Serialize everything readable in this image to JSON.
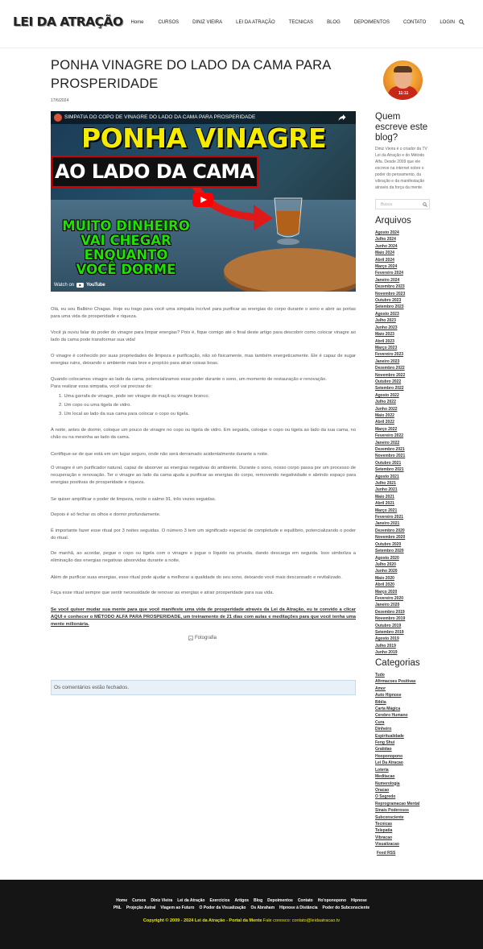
{
  "header": {
    "logo": "LEI DA ATRAÇÃO",
    "nav": [
      "Home",
      "CURSOS",
      "DINIZ VIEIRA",
      "LEI DA ATRAÇÃO",
      "TECNICAS",
      "BLOG",
      "DEPOIMENTOS",
      "CONTATO",
      "LOGIN"
    ],
    "search_icon": "search-icon"
  },
  "post": {
    "title": "PONHA VINAGRE DO LADO DA CAMA PARA PROSPERIDADE",
    "date": "17/6/2024",
    "video": {
      "top_title": "SIMPATIA DO COPO DE VINAGRE DO LADO DA CAMA PARA PROSPERIDADE",
      "thumb_line1": "PONHA VINAGRE",
      "thumb_line2": "AO LADO DA CAMA",
      "thumb_line3": [
        "MUITO DINHEIRO",
        "VAI CHEGAR",
        "ENQUANTO",
        "VOCÊ DORME"
      ],
      "watch_on": "Watch on",
      "platform": "YouTube"
    },
    "paragraphs": [
      "Olá, eu sou Balbino Chagas. Hoje eu trago para você uma simpatia incrível para purificar as energias do corpo durante o sono e abrir as portas para uma vida de prosperidade e riqueza.",
      "Você já ouviu falar do poder do vinagre para limpar energias? Pois é, fique comigo até o final deste artigo para descobrir como colocar vinagre ao lado da cama pode transformar sua vida!",
      "O vinagre é conhecido por suas propriedades de limpeza e purificação, não só fisicamente, mas também energeticamente. Ele é capaz de sugar energias ruins, deixando o ambiente mais leve e propício para atrair coisas boas.",
      "Quando colocamos vinagre ao lado da cama, potencializamos esse poder durante o sono, um momento de restauração e renovação.",
      "Para realizar essa simpatia, você vai precisar de:"
    ],
    "list": [
      "1.  Uma garrafa de vinagre, pode ser vinagre de maçã ou vinagre branco.",
      "2.  Um copo ou uma tigela de vidro.",
      "3.  Um local ao lado da sua cama para colocar o copo ou tigela."
    ],
    "paragraphs2": [
      "À noite, antes de dormir, coloque um pouco de vinagre no copo ou tigela de vidro. Em seguida, coloque o copo ou tigela ao lado da sua cama, no chão ou na mesinha ao lado da cama.",
      "Certifique-se de que está em um lugar seguro, onde não será derramado acidentalmente durante a noite.",
      "O vinagre é um purificador natural, capaz de absorver as energias negativas do ambiente. Durante o sono, nosso corpo passa por um processo de recuperação e renovação. Ter o vinagre ao lado da cama ajuda a purificar as energias do corpo, removendo negatividade e abrindo espaço para energias positivas de prosperidade e riqueza.",
      "Se quiser amplificar o poder de limpeza, recite o salmo 91, três vezes seguidas.",
      "Depois é só fechar os olhos e dormir profundamente.",
      "É importante fazer esse ritual por 3 noites seguidas. O número 3 tem um significado especial de completude e equilíbrio, potencializando o poder do ritual.",
      "De manhã, ao acordar, pegue o copo ou tigela com o vinagre e jogue o líquido na privada, dando descarga em seguida. Isso simboliza a eliminação das energias negativas absorvidas durante a noite.",
      "Além de purificar suas energias, esse ritual pode ajudar a melhorar a qualidade do seu sono, deixando você mais descansado e revitalizado.",
      "Faça esse ritual sempre que sentir necessidade de renovar as energias e atrair prosperidade para sua vida."
    ],
    "cta": "Se você quiser mudar sua mente para que você manifeste uma vida de prosperidade através da Lei da Atração, eu te convido a clicar AQUI e conhecer o MÉTODO ALFA PARA PROSPERIDADE, um treinamento de 21 dias com aulas e meditações para que você tenha uma mente milionária.",
    "image_alt": "Fotografia",
    "comments_closed": "Os comentários estão fechados."
  },
  "sidebar": {
    "author_shirt_text": "11:11",
    "about_title": "Quem escreve este blog?",
    "about_text": "Diniz Vieira é o criador da TV Lei da Atração e do Método Alfa. Desde 2009 que ele escreve na internet sobre o poder do pensamento, da vibração e da manifestação através da força da mente.",
    "search_placeholder": "Busca",
    "archives_title": "Arquivos",
    "archives": [
      "Agosto 2024",
      "Julho 2024",
      "Junho 2024",
      "Maio 2024",
      "Abril 2024",
      "Março 2024",
      "Fevereiro 2024",
      "Janeiro 2024",
      "Dezembro 2023",
      "Novembro 2023",
      "Outubro 2023",
      "Setembro 2023",
      "Agosto 2023",
      "Julho 2023",
      "Junho 2023",
      "Maio 2023",
      "Abril 2023",
      "Março 2023",
      "Fevereiro 2023",
      "Janeiro 2023",
      "Dezembro 2022",
      "Novembro 2022",
      "Outubro 2022",
      "Setembro 2022",
      "Agosto 2022",
      "Julho 2022",
      "Junho 2022",
      "Maio 2022",
      "Abril 2022",
      "Março 2022",
      "Fevereiro 2022",
      "Janeiro 2022",
      "Dezembro 2021",
      "Novembro 2021",
      "Outubro 2021",
      "Setembro 2021",
      "Agosto 2021",
      "Julho 2021",
      "Junho 2021",
      "Maio 2021",
      "Abril 2021",
      "Março 2021",
      "Fevereiro 2021",
      "Janeiro 2021",
      "Dezembro 2020",
      "Novembro 2020",
      "Outubro 2020",
      "Setembro 2020",
      "Agosto 2020",
      "Julho 2020",
      "Junho 2020",
      "Maio 2020",
      "Abril 2020",
      "Março 2020",
      "Fevereiro 2020",
      "Janeiro 2020",
      "Dezembro 2019",
      "Novembro 2019",
      "Outubro 2019",
      "Setembro 2019",
      "Agosto 2019",
      "Julho 2019",
      "Junho 2019"
    ],
    "categories_title": "Categorias",
    "categories": [
      "Tudo",
      "Afirmacoes Positivas",
      "Amor",
      "Auto Hipnose",
      "Bíblia",
      "Carta Mágica",
      "Cerebro Humano",
      "Cura",
      "Dinheiro",
      "Espiritualidade",
      "Feng Shui",
      "Gratidao",
      "Hooponopono",
      "Lei Da Atracao",
      "Loteria",
      "Meditacao",
      "Numerologia",
      "Oracao",
      "O Segredo",
      "Reprogramacao Mental",
      "Sinais Poderosos",
      "Subconsciente",
      "Tecnicas",
      "Telepatia",
      "Vibracao",
      "Visualizacao"
    ],
    "feed": "Feed RSS"
  },
  "footer": {
    "links_row1": [
      "Home",
      "Cursos",
      "Diniz Vieira",
      "Lei da Atração",
      "Exercícios",
      "Artigos",
      "Blog",
      "Depoimentos",
      "Contato",
      "Ho'oponopono",
      "Hipnose"
    ],
    "links_row2": [
      "PNL",
      "Projeção Astral",
      "Viagem ao Futuro",
      "O Poder da Visualização",
      "Os Abraham",
      "Hipnose à Distância",
      "Poder do Subconsciente"
    ],
    "copyright": "Copyright © 2009 - 2024 Lei da Atração - Portal da Mente",
    "contact_label": "Fale conosco:",
    "contact_email": "contato@leidaatracao.tv"
  }
}
